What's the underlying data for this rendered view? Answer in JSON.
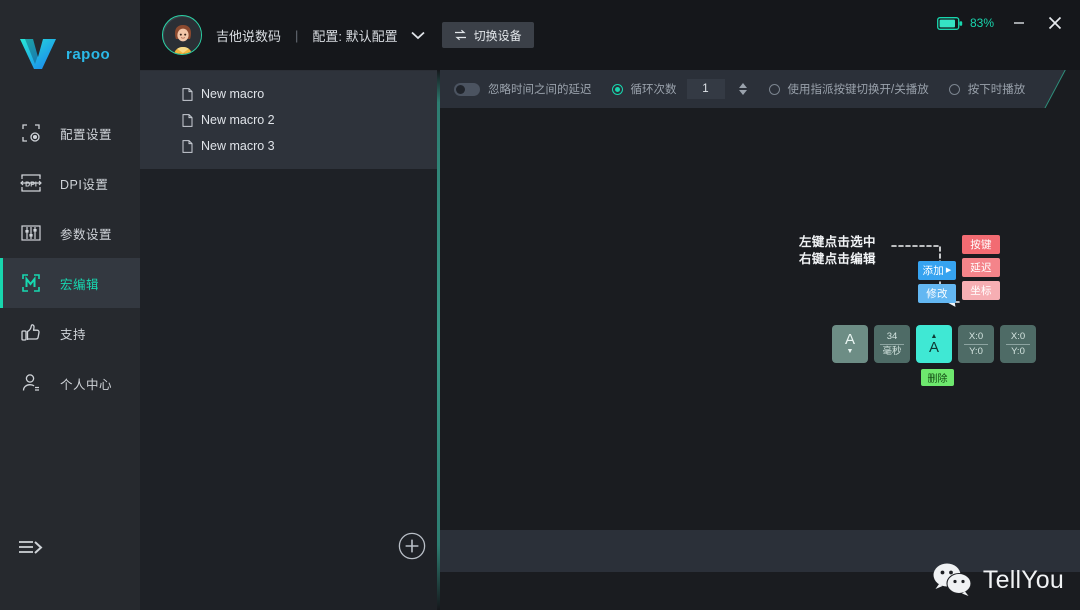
{
  "app": {
    "brand_name": "rapoo"
  },
  "sidebar": {
    "items": [
      {
        "id": "config",
        "label": "配置设置",
        "icon": "config-gear-icon",
        "active": false
      },
      {
        "id": "dpi",
        "label": "DPI设置",
        "icon": "dpi-icon",
        "active": false
      },
      {
        "id": "params",
        "label": "参数设置",
        "icon": "sliders-icon",
        "active": false
      },
      {
        "id": "macro",
        "label": "宏编辑",
        "icon": "macro-m-icon",
        "active": true
      },
      {
        "id": "support",
        "label": "支持",
        "icon": "thumbs-up-icon",
        "active": false
      },
      {
        "id": "account",
        "label": "个人中心",
        "icon": "user-icon",
        "active": false
      }
    ],
    "collapse_icon": "menu-expand-icon"
  },
  "topbar": {
    "avatar_icon": "user-avatar",
    "user_name": "吉他说数码",
    "separator": "|",
    "profile_label": "配置: 默认配置",
    "profile_chevron_icon": "chevron-down-icon",
    "switch_device_label": "切换设备",
    "switch_device_icon": "swap-icon",
    "battery_icon": "battery-icon",
    "battery_percent": "83%",
    "minimize_icon": "minimize-icon",
    "close_icon": "close-icon"
  },
  "macro_panel": {
    "items": [
      {
        "icon": "file-icon",
        "label": "New macro"
      },
      {
        "icon": "file-icon",
        "label": "New macro 2"
      },
      {
        "icon": "file-icon",
        "label": "New macro 3"
      }
    ],
    "add_button_icon": "plus-circle-icon"
  },
  "editor_toolbar": {
    "ignore_delay_label": "忽略时间之间的延迟",
    "ignore_delay_toggle": "off",
    "loop_count_label": "循环次数",
    "loop_count_value": "1",
    "loop_count_selected": true,
    "spinner_icon": "spinner-up-down-icon",
    "toggle_play_label": "使用指派按键切换开/关播放",
    "toggle_play_selected": false,
    "hold_play_label": "按下时播放",
    "hold_play_selected": false
  },
  "annotation": {
    "line1": "左键点击选中",
    "line2": "右键点击编辑",
    "menu_blue": [
      {
        "label": "添加",
        "caret": "▶",
        "style": "blue"
      },
      {
        "label": "修改",
        "caret": "",
        "style": "blue2"
      }
    ],
    "menu_red": [
      {
        "label": "按键",
        "style": "red1"
      },
      {
        "label": "延迟",
        "style": "red2"
      },
      {
        "label": "坐标",
        "style": "red3"
      }
    ],
    "delete_chip": "删除"
  },
  "macro_steps": [
    {
      "type": "key",
      "glyph": "A",
      "arrow": "▼",
      "selected": false
    },
    {
      "type": "delay",
      "top": "34",
      "bottom": "毫秒"
    },
    {
      "type": "key",
      "glyph": "A",
      "arrow": "▲",
      "selected": true
    },
    {
      "type": "coord",
      "top": "X:0",
      "bottom": "Y:0"
    },
    {
      "type": "coord",
      "top": "X:0",
      "bottom": "Y:0"
    }
  ],
  "watermark": {
    "icon": "wechat-icon",
    "text": "TellYou"
  }
}
